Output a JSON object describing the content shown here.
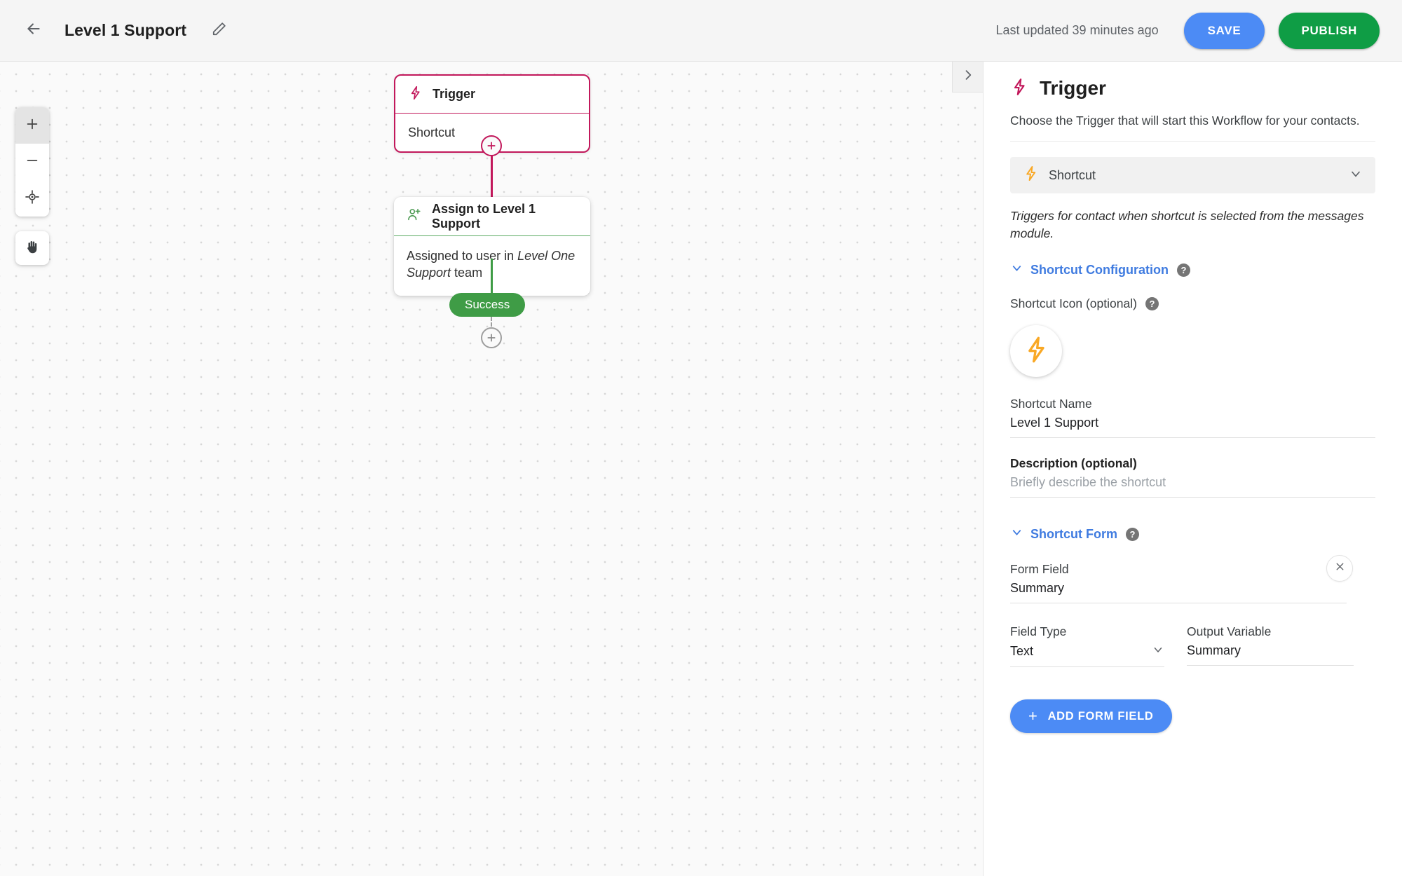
{
  "header": {
    "back_icon": "arrow-left-icon",
    "title": "Level 1 Support",
    "edit_icon": "pencil-icon",
    "last_updated": "Last updated 39 minutes ago",
    "save_label": "SAVE",
    "publish_label": "PUBLISH",
    "save_color": "#4c8bf5",
    "publish_color": "#0f9d45"
  },
  "canvas": {
    "zoom_controls": {
      "zoom_in_icon": "plus-icon",
      "zoom_out_icon": "minus-icon",
      "recenter_icon": "crosshair-icon",
      "pan_icon": "hand-icon"
    },
    "nodes": [
      {
        "icon": "lightning-bolt-icon",
        "title": "Trigger",
        "body": "Shortcut",
        "accent": "#c2185b"
      },
      {
        "icon": "person-add-icon",
        "title": "Assign to Level 1 Support",
        "body_prefix": "Assigned to user in ",
        "body_emphasis": "Level One Support",
        "body_suffix": " team",
        "accent": "#5caa63"
      }
    ],
    "success_badge": "Success",
    "add_step_icon": "plus-circle-icon",
    "collapse_tab_icon": "chevron-right-icon"
  },
  "panel": {
    "icon": "lightning-bolt-icon",
    "title": "Trigger",
    "description": "Choose the Trigger that will start this Workflow for your contacts.",
    "trigger_select": {
      "icon": "lightning-bolt-icon",
      "value": "Shortcut",
      "chevron": "chevron-down-icon"
    },
    "trigger_note": "Triggers for contact when shortcut is selected from the messages module.",
    "shortcut_configuration": {
      "section_label": "Shortcut Configuration",
      "collapse_icon": "chevron-down-icon",
      "help_icon": "help-icon",
      "icon_label": "Shortcut Icon (optional)",
      "icon_help": "help-icon",
      "avatar_icon": "lightning-bolt-icon",
      "avatar_color": "#f9a825",
      "name_label": "Shortcut Name",
      "name_value": "Level 1 Support",
      "description_label": "Description (optional)",
      "description_placeholder": "Briefly describe the shortcut"
    },
    "shortcut_form": {
      "section_label": "Shortcut Form",
      "collapse_icon": "chevron-down-icon",
      "help_icon": "help-icon",
      "remove_icon": "close-icon",
      "form_field_label": "Form Field",
      "form_field_value": "Summary",
      "field_type_label": "Field Type",
      "field_type_value": "Text",
      "field_type_chevron": "chevron-down-icon",
      "output_variable_label": "Output Variable",
      "output_variable_value": "Summary",
      "add_button_label": "ADD FORM FIELD",
      "add_button_icon": "plus-icon"
    }
  }
}
